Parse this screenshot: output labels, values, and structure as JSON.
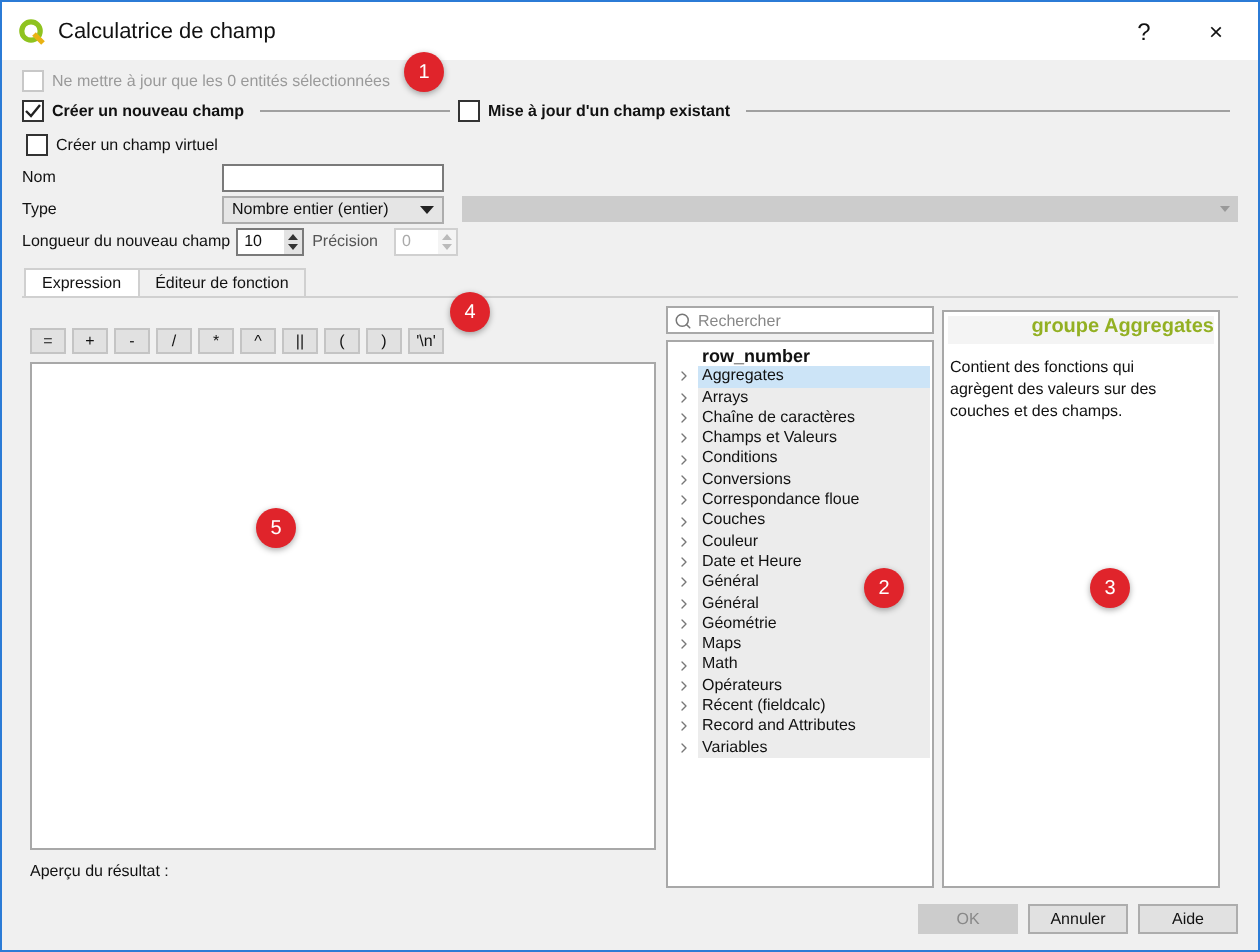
{
  "window": {
    "title": "Calculatrice de champ",
    "help_button": "?",
    "close_button": "×"
  },
  "selected_only": {
    "label": "Ne mettre à jour que les 0 entités sélectionnées",
    "checked": false,
    "disabled": true
  },
  "new_field": {
    "label": "Créer un nouveau champ",
    "checked": true
  },
  "update_field": {
    "label": "Mise à jour d'un champ existant",
    "checked": false
  },
  "virtual_field": {
    "label": "Créer un champ virtuel",
    "checked": false
  },
  "form": {
    "name_label": "Nom",
    "type_label": "Type",
    "type_value": "Nombre entier (entier)",
    "length_label": "Longueur du nouveau champ",
    "length_value": "10",
    "precision_label": "Précision",
    "precision_value": "0",
    "precision_disabled": true
  },
  "tabs": [
    {
      "label": "Expression",
      "selected": true
    },
    {
      "label": "Éditeur de fonction",
      "selected": false
    }
  ],
  "operators": [
    "=",
    "+",
    "-",
    "/",
    "*",
    "^",
    "||",
    "(",
    ")",
    "'\\n'"
  ],
  "search": {
    "placeholder": "Rechercher"
  },
  "functions": [
    {
      "label": "row_number",
      "kind": "item",
      "selected": false
    },
    {
      "label": "Aggregates",
      "kind": "group",
      "selected": true
    },
    {
      "label": "Arrays",
      "kind": "group",
      "selected": false
    },
    {
      "label": "Chaîne de caractères",
      "kind": "group",
      "selected": false
    },
    {
      "label": "Champs et Valeurs",
      "kind": "group",
      "selected": false
    },
    {
      "label": "Conditions",
      "kind": "group",
      "selected": false
    },
    {
      "label": "Conversions",
      "kind": "group",
      "selected": false
    },
    {
      "label": "Correspondance floue",
      "kind": "group",
      "selected": false
    },
    {
      "label": "Couches",
      "kind": "group",
      "selected": false
    },
    {
      "label": "Couleur",
      "kind": "group",
      "selected": false
    },
    {
      "label": "Date et Heure",
      "kind": "group",
      "selected": false
    },
    {
      "label": "Général",
      "kind": "group",
      "selected": false
    },
    {
      "label": "Général",
      "kind": "group",
      "selected": false
    },
    {
      "label": "Géométrie",
      "kind": "group",
      "selected": false
    },
    {
      "label": "Maps",
      "kind": "group",
      "selected": false
    },
    {
      "label": "Math",
      "kind": "group",
      "selected": false
    },
    {
      "label": "Opérateurs",
      "kind": "group",
      "selected": false
    },
    {
      "label": "Récent (fieldcalc)",
      "kind": "group",
      "selected": false
    },
    {
      "label": "Record and Attributes",
      "kind": "group",
      "selected": false
    },
    {
      "label": "Variables",
      "kind": "group",
      "selected": false
    }
  ],
  "help": {
    "title": "groupe Aggregates",
    "text": "Contient des fonctions qui agrègent des valeurs sur des couches et des champs."
  },
  "preview_label": "Aperçu du résultat :",
  "buttons": [
    {
      "label": "OK",
      "disabled": true
    },
    {
      "label": "Annuler",
      "disabled": false
    },
    {
      "label": "Aide",
      "disabled": false
    }
  ],
  "annotations": [
    "1",
    "2",
    "3",
    "4",
    "5"
  ]
}
